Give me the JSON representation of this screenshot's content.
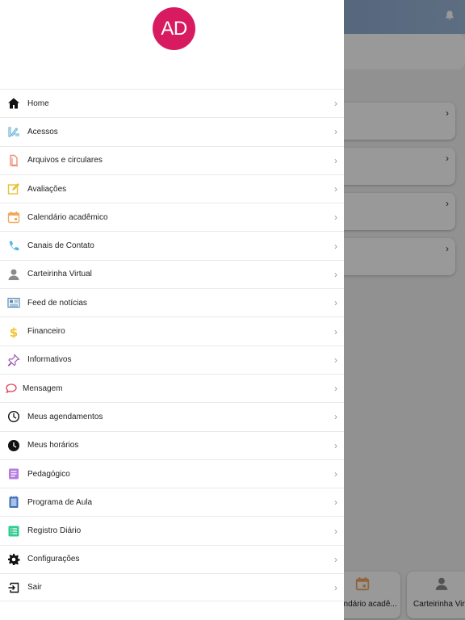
{
  "background": {
    "cards": [
      {
        "chevron": "›"
      },
      {
        "chevron": "›"
      },
      {
        "chevron": "›"
      },
      {
        "chevron": "›"
      }
    ],
    "tiles": [
      {
        "icon": "calendar-icon",
        "label": "endário acadê..."
      },
      {
        "icon": "person-icon",
        "label": "Carteirinha Virtu"
      }
    ]
  },
  "drawer": {
    "avatar_initials": "AD",
    "avatar_color": "#d81b60",
    "items": [
      {
        "label": "Home",
        "icon": "home-icon",
        "color": "#111111"
      },
      {
        "label": "Acessos",
        "icon": "access-icon",
        "color": "#6fb7d9"
      },
      {
        "label": "Arquivos e circulares",
        "icon": "files-icon",
        "color": "#f0907a"
      },
      {
        "label": "Avaliações",
        "icon": "edit-icon",
        "color": "#e8c233"
      },
      {
        "label": "Calendário acadêmico",
        "icon": "calendar-icon",
        "color": "#f0a960"
      },
      {
        "label": "Canais de Contato",
        "icon": "phone-icon",
        "color": "#49b7e6"
      },
      {
        "label": "Carteirinha Virtual",
        "icon": "person-icon",
        "color": "#8a8a8a"
      },
      {
        "label": "Feed de notícias",
        "icon": "news-icon",
        "color": "#5b8bb5"
      },
      {
        "label": "Financeiro",
        "icon": "dollar-icon",
        "color": "#f2c230"
      },
      {
        "label": "Informativos",
        "icon": "pin-icon",
        "color": "#9b59b6"
      },
      {
        "label": "Mensagem",
        "icon": "chat-icon",
        "color": "#e0455c"
      },
      {
        "label": "Meus agendamentos",
        "icon": "clock-outline-icon",
        "color": "#111111"
      },
      {
        "label": "Meus horários",
        "icon": "clock-filled-icon",
        "color": "#111111"
      },
      {
        "label": "Pedagógico",
        "icon": "document-icon",
        "color": "#b57be0"
      },
      {
        "label": "Programa de Aula",
        "icon": "notebook-icon",
        "color": "#3e6db5"
      },
      {
        "label": "Registro Diário",
        "icon": "list-icon",
        "color": "#2ecc8f"
      },
      {
        "label": "Configurações",
        "icon": "gear-icon",
        "color": "#111111"
      },
      {
        "label": "Sair",
        "icon": "logout-icon",
        "color": "#111111"
      }
    ]
  }
}
